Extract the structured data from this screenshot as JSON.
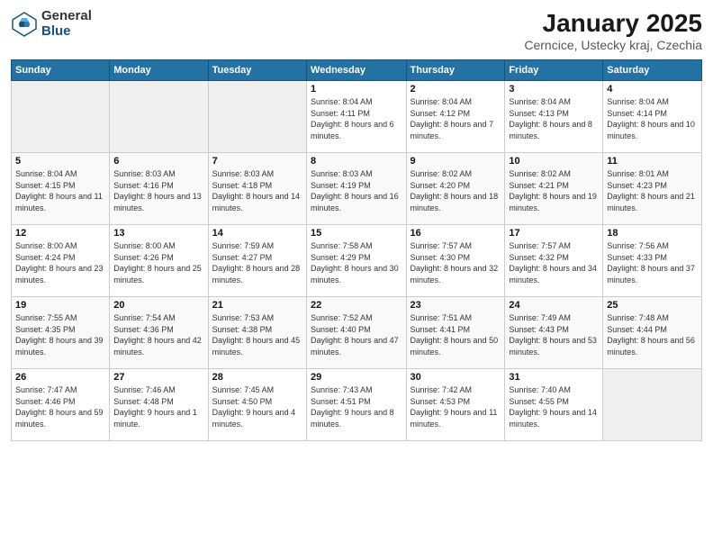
{
  "logo": {
    "general": "General",
    "blue": "Blue"
  },
  "title": "January 2025",
  "location": "Cerncice, Ustecky kraj, Czechia",
  "weekdays": [
    "Sunday",
    "Monday",
    "Tuesday",
    "Wednesday",
    "Thursday",
    "Friday",
    "Saturday"
  ],
  "weeks": [
    [
      {
        "day": "",
        "info": ""
      },
      {
        "day": "",
        "info": ""
      },
      {
        "day": "",
        "info": ""
      },
      {
        "day": "1",
        "info": "Sunrise: 8:04 AM\nSunset: 4:11 PM\nDaylight: 8 hours and 6 minutes."
      },
      {
        "day": "2",
        "info": "Sunrise: 8:04 AM\nSunset: 4:12 PM\nDaylight: 8 hours and 7 minutes."
      },
      {
        "day": "3",
        "info": "Sunrise: 8:04 AM\nSunset: 4:13 PM\nDaylight: 8 hours and 8 minutes."
      },
      {
        "day": "4",
        "info": "Sunrise: 8:04 AM\nSunset: 4:14 PM\nDaylight: 8 hours and 10 minutes."
      }
    ],
    [
      {
        "day": "5",
        "info": "Sunrise: 8:04 AM\nSunset: 4:15 PM\nDaylight: 8 hours and 11 minutes."
      },
      {
        "day": "6",
        "info": "Sunrise: 8:03 AM\nSunset: 4:16 PM\nDaylight: 8 hours and 13 minutes."
      },
      {
        "day": "7",
        "info": "Sunrise: 8:03 AM\nSunset: 4:18 PM\nDaylight: 8 hours and 14 minutes."
      },
      {
        "day": "8",
        "info": "Sunrise: 8:03 AM\nSunset: 4:19 PM\nDaylight: 8 hours and 16 minutes."
      },
      {
        "day": "9",
        "info": "Sunrise: 8:02 AM\nSunset: 4:20 PM\nDaylight: 8 hours and 18 minutes."
      },
      {
        "day": "10",
        "info": "Sunrise: 8:02 AM\nSunset: 4:21 PM\nDaylight: 8 hours and 19 minutes."
      },
      {
        "day": "11",
        "info": "Sunrise: 8:01 AM\nSunset: 4:23 PM\nDaylight: 8 hours and 21 minutes."
      }
    ],
    [
      {
        "day": "12",
        "info": "Sunrise: 8:00 AM\nSunset: 4:24 PM\nDaylight: 8 hours and 23 minutes."
      },
      {
        "day": "13",
        "info": "Sunrise: 8:00 AM\nSunset: 4:26 PM\nDaylight: 8 hours and 25 minutes."
      },
      {
        "day": "14",
        "info": "Sunrise: 7:59 AM\nSunset: 4:27 PM\nDaylight: 8 hours and 28 minutes."
      },
      {
        "day": "15",
        "info": "Sunrise: 7:58 AM\nSunset: 4:29 PM\nDaylight: 8 hours and 30 minutes."
      },
      {
        "day": "16",
        "info": "Sunrise: 7:57 AM\nSunset: 4:30 PM\nDaylight: 8 hours and 32 minutes."
      },
      {
        "day": "17",
        "info": "Sunrise: 7:57 AM\nSunset: 4:32 PM\nDaylight: 8 hours and 34 minutes."
      },
      {
        "day": "18",
        "info": "Sunrise: 7:56 AM\nSunset: 4:33 PM\nDaylight: 8 hours and 37 minutes."
      }
    ],
    [
      {
        "day": "19",
        "info": "Sunrise: 7:55 AM\nSunset: 4:35 PM\nDaylight: 8 hours and 39 minutes."
      },
      {
        "day": "20",
        "info": "Sunrise: 7:54 AM\nSunset: 4:36 PM\nDaylight: 8 hours and 42 minutes."
      },
      {
        "day": "21",
        "info": "Sunrise: 7:53 AM\nSunset: 4:38 PM\nDaylight: 8 hours and 45 minutes."
      },
      {
        "day": "22",
        "info": "Sunrise: 7:52 AM\nSunset: 4:40 PM\nDaylight: 8 hours and 47 minutes."
      },
      {
        "day": "23",
        "info": "Sunrise: 7:51 AM\nSunset: 4:41 PM\nDaylight: 8 hours and 50 minutes."
      },
      {
        "day": "24",
        "info": "Sunrise: 7:49 AM\nSunset: 4:43 PM\nDaylight: 8 hours and 53 minutes."
      },
      {
        "day": "25",
        "info": "Sunrise: 7:48 AM\nSunset: 4:44 PM\nDaylight: 8 hours and 56 minutes."
      }
    ],
    [
      {
        "day": "26",
        "info": "Sunrise: 7:47 AM\nSunset: 4:46 PM\nDaylight: 8 hours and 59 minutes."
      },
      {
        "day": "27",
        "info": "Sunrise: 7:46 AM\nSunset: 4:48 PM\nDaylight: 9 hours and 1 minute."
      },
      {
        "day": "28",
        "info": "Sunrise: 7:45 AM\nSunset: 4:50 PM\nDaylight: 9 hours and 4 minutes."
      },
      {
        "day": "29",
        "info": "Sunrise: 7:43 AM\nSunset: 4:51 PM\nDaylight: 9 hours and 8 minutes."
      },
      {
        "day": "30",
        "info": "Sunrise: 7:42 AM\nSunset: 4:53 PM\nDaylight: 9 hours and 11 minutes."
      },
      {
        "day": "31",
        "info": "Sunrise: 7:40 AM\nSunset: 4:55 PM\nDaylight: 9 hours and 14 minutes."
      },
      {
        "day": "",
        "info": ""
      }
    ]
  ]
}
